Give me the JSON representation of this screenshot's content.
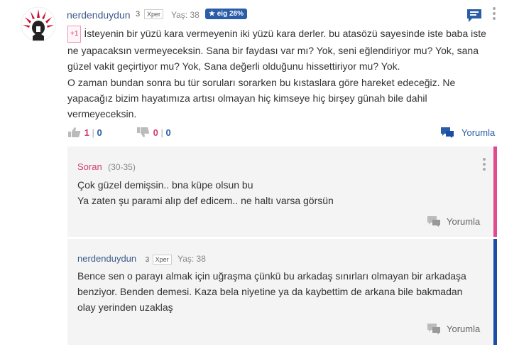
{
  "post": {
    "username": "nerdenduydun",
    "level": "3",
    "xper_label": "Xper",
    "age_label": "Yaş: 38",
    "badge_label": "eig 28%",
    "plus_label": "+1",
    "paragraph1": "İsteyenin bir yüzü kara vermeyenin iki yüzü kara derler. bu atasözü sayesinde iste baba iste ne yapacaksın vermeyeceksin. Sana bir faydası var mı? Yok, seni eğlendiriyor mu? Yok, sana güzel vakit geçirtiyor mu? Yok, Sana değerli olduğunu hissettiriyor mu? Yok.",
    "paragraph2": "O zaman bundan sonra bu tür soruları sorarken bu kıstaslara göre hareket edeceğiz. Ne yapacağız bizim hayatımıza artısı olmayan hiç kimseye hiç birşey günah bile dahil vermeyeceksin.",
    "upvotes_pink": "1",
    "upvotes_blue": "0",
    "downvotes_pink": "0",
    "downvotes_blue": "0",
    "separator": "|",
    "reply_label": "Yorumla"
  },
  "replies": [
    {
      "username": "Soran",
      "age_range": "(30-35)",
      "line1": "Çok güzel demişsin.. bna küpe olsun bu",
      "line2": "Ya zaten şu parami alıp def edicem.. ne haltı varsa görsün",
      "reply_label": "Yorumla",
      "accent": "#e34a8d"
    },
    {
      "username": "nerdenduydun",
      "level": "3",
      "xper_label": "Xper",
      "age_label": "Yaş: 38",
      "text": "Bence sen o parayı almak için uğraşma çünkü bu arkadaş sınırları olmayan bir arkadaşa benziyor. Benden demesi. Kaza bela niyetine ya da kaybettim de arkana bile bakmadan olay yerinden uzaklaş",
      "reply_label": "Yorumla",
      "accent": "#184da8"
    }
  ],
  "colors": {
    "link": "#3c5a88",
    "accent_blue": "#2a5da8",
    "accent_pink": "#d23e6f"
  }
}
